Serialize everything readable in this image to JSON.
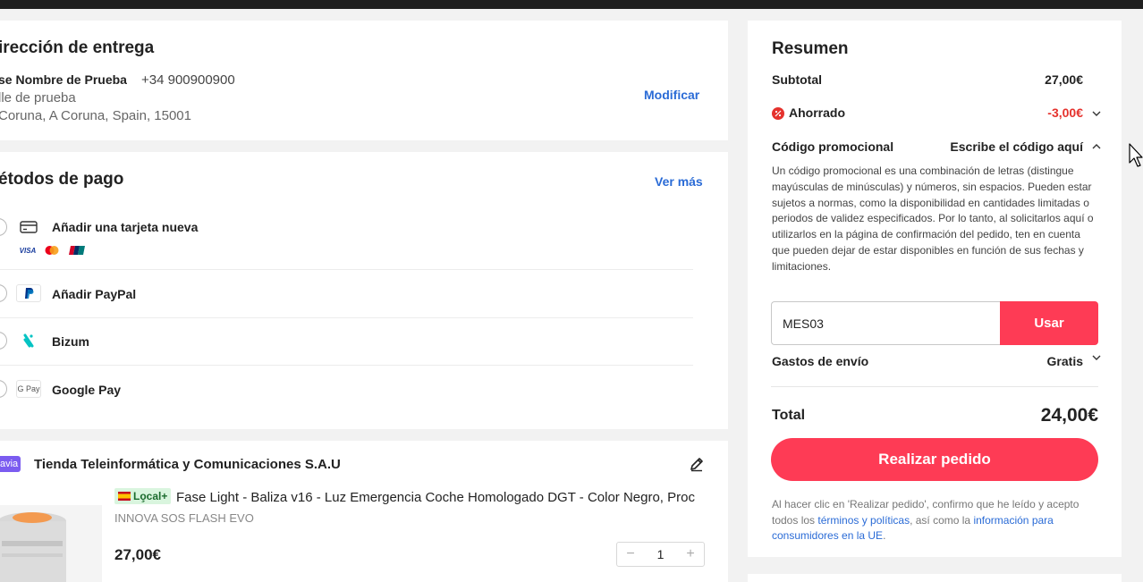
{
  "address": {
    "title": "irección de entrega",
    "name": "se Nombre de Prueba",
    "phone": "+34 900900900",
    "street": "lle de prueba",
    "city": "Coruna, A Coruna, Spain, 15001",
    "modify": "Modificar"
  },
  "payment": {
    "title": "étodos de pago",
    "see_more": "Ver más",
    "methods": [
      {
        "label": "Añadir una tarjeta nueva",
        "icon": "credit-card-icon"
      },
      {
        "label": "Añadir PayPal",
        "icon": "paypal-icon"
      },
      {
        "label": "Bizum",
        "icon": "bizum-icon"
      },
      {
        "label": "Google Pay",
        "icon": "google-pay-icon"
      }
    ],
    "card_brands": [
      "VISA",
      "Mastercard",
      "UnionPay"
    ],
    "gpay_text": "G Pay"
  },
  "shop": {
    "badge": "avia",
    "name": "Tienda Teleinformática y Comunicaciones S.A.U",
    "product": {
      "badge": "Lo̧cal+",
      "title": "Fase Light - Baliza v16 - Luz Emergencia Coche Homologado DGT - Color Negro, Proc",
      "brand": "INNOVA SOS FLASH EVO",
      "price": "27,00€",
      "qty": "1",
      "minus": "−",
      "plus": "+"
    }
  },
  "summary": {
    "title": "Resumen",
    "subtotal_label": "Subtotal",
    "subtotal_value": "27,00€",
    "saved_label": "Ahorrado",
    "saved_value": "-3,00€",
    "promo_label": "Código promocional",
    "promo_action": "Escribe el código aquí",
    "promo_desc": "Un código promocional es una combinación de letras (distingue mayúsculas de minúsculas) y números, sin espacios. Pueden estar sujetos a normas, como la disponibilidad en cantidades limitadas o periodos de validez especificados. Por lo tanto, al solicitarlos aquí o utilizarlos en la página de confirmación del pedido, ten en cuenta que pueden dejar de estar disponibles en función de sus fechas y limitaciones.",
    "promo_value": "MES03",
    "apply": "Usar",
    "shipping_label": "Gastos de envío",
    "shipping_value": "Gratis",
    "total_label": "Total",
    "total_value": "24,00€",
    "order_button": "Realizar pedido",
    "legal_pre": "Al hacer clic en 'Realizar pedido', confirmo que he leído y acepto todos los ",
    "legal_link1": "términos y políticas",
    "legal_mid": ", así como la ",
    "legal_link2": "información para consumidores en la UE",
    "legal_post": "."
  },
  "colors": {
    "accent": "#fe3b55",
    "link": "#2a6bd6",
    "discount": "#e5322d"
  }
}
